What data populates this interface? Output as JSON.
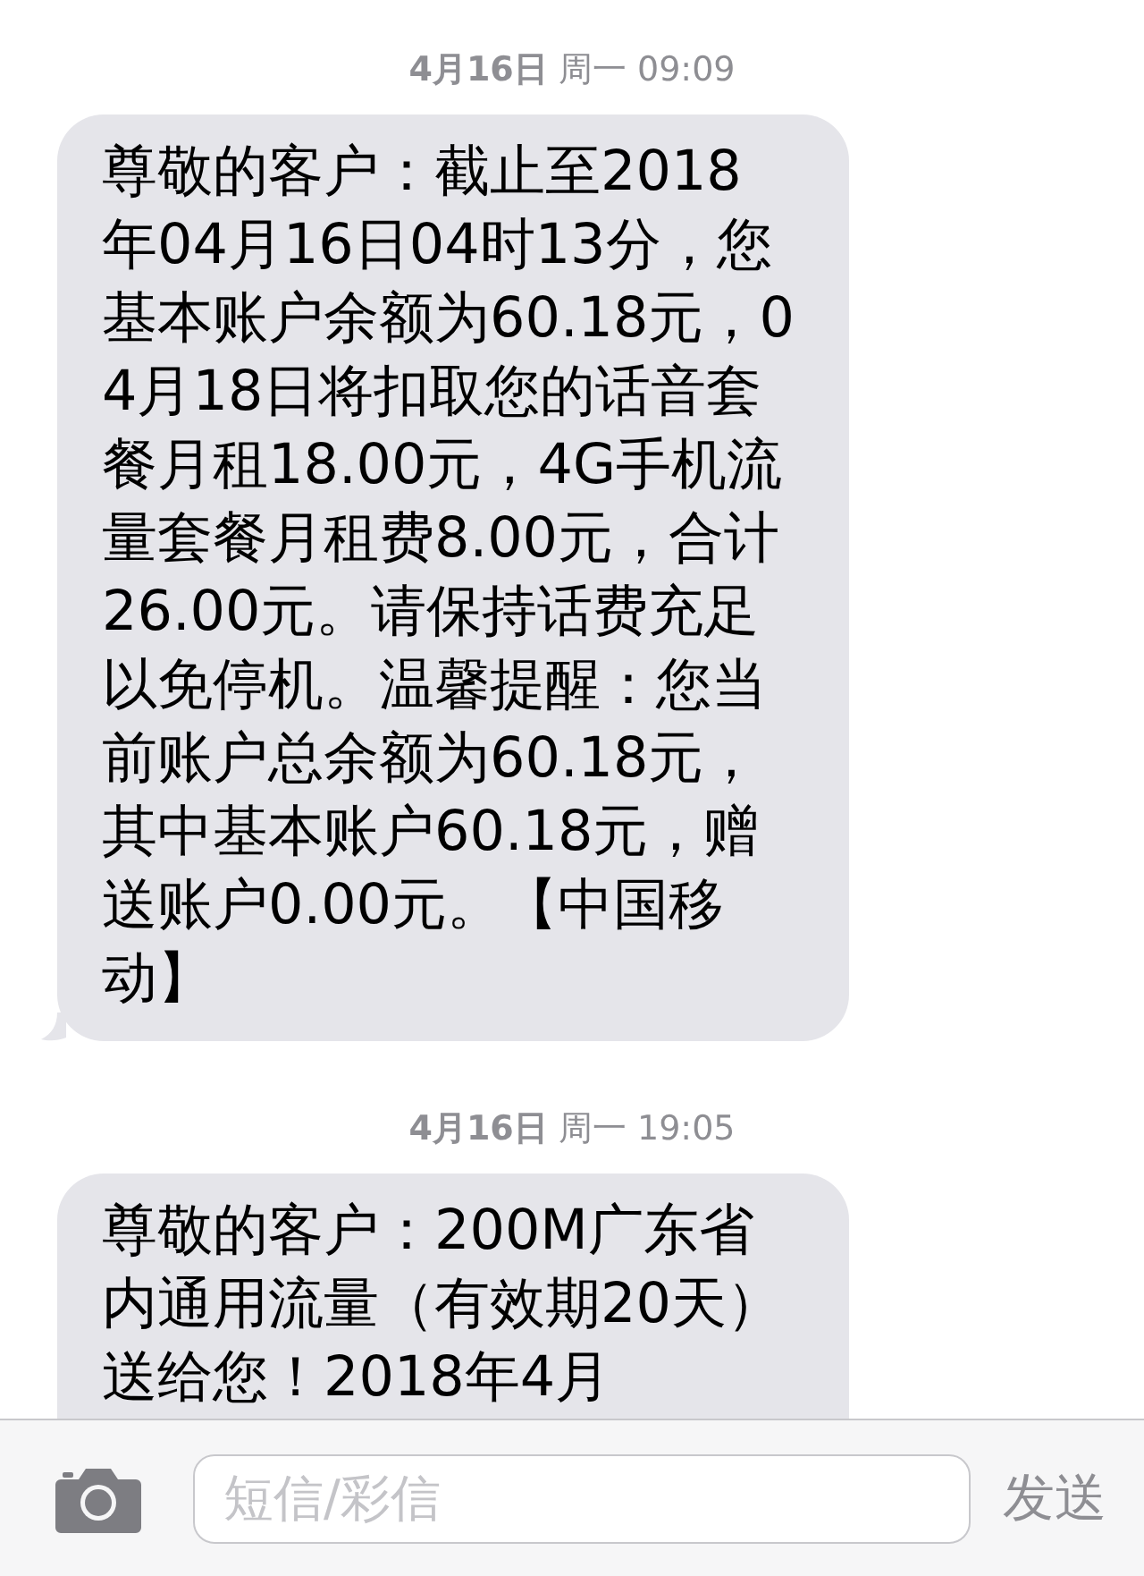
{
  "messages": [
    {
      "timestamp": "**4月16日** 周一 09:09",
      "text": "尊敬的客户：截止至2018年04月16日04时13分，您基本账户余额为60.18元，04月18日将扣取您的话音套餐月租18.00元，4G手机流量套餐月租费8.00元，合计26.00元。请保持话费充足以免停机。温馨提醒：您当前账户总余额为60.18元，其中基本账户60.18元，赠送账户0.00元。【中国移动】"
    },
    {
      "timestamp": "**4月16日** 周一 19:05",
      "text": "尊敬的客户：200M广东省内通用流量（有效期20天）送给您！2018年4月"
    }
  ],
  "compose": {
    "placeholder": "短信/彩信",
    "send": "发送",
    "send_disabled": true
  }
}
